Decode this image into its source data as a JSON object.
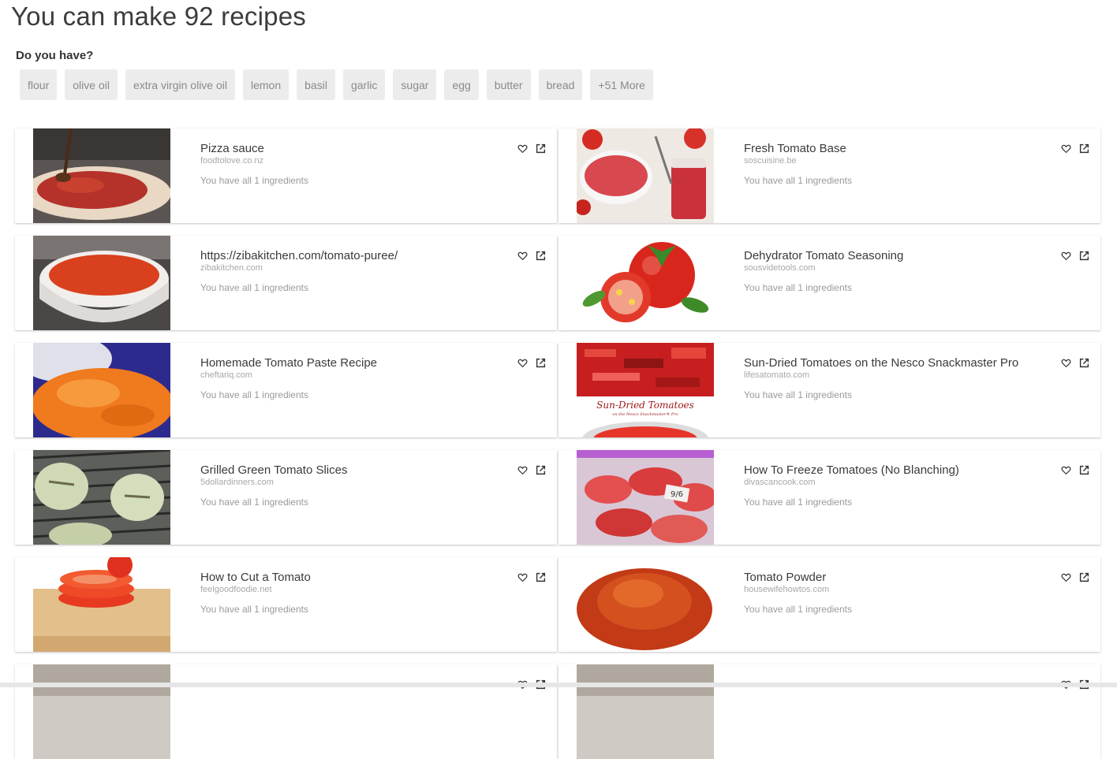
{
  "page": {
    "title": "You can make 92 recipes",
    "subheading": "Do you have?"
  },
  "chips": [
    "flour",
    "olive oil",
    "extra virgin olive oil",
    "lemon",
    "basil",
    "garlic",
    "sugar",
    "egg",
    "butter",
    "bread",
    "+51 More"
  ],
  "recipes": [
    {
      "title": "Pizza sauce",
      "source": "foodtolove.co.nz",
      "have": "You have all 1 ingredients",
      "image": "pizza-sauce-photo"
    },
    {
      "title": "Fresh Tomato Base",
      "source": "soscuisine.be",
      "have": "You have all 1 ingredients",
      "image": "tomato-base-photo"
    },
    {
      "title": "https://zibakitchen.com/tomato-puree/",
      "source": "zibakitchen.com",
      "have": "You have all 1 ingredients",
      "image": "tomato-puree-photo"
    },
    {
      "title": "Dehydrator Tomato Seasoning",
      "source": "sousvidetools.com",
      "have": "You have all 1 ingredients",
      "image": "tomatoes-photo"
    },
    {
      "title": "Homemade Tomato Paste Recipe",
      "source": "cheftariq.com",
      "have": "You have all 1 ingredients",
      "image": "tomato-paste-photo"
    },
    {
      "title": "Sun-Dried Tomatoes on the Nesco Snackmaster Pro",
      "source": "lifesatomato.com",
      "have": "You have all 1 ingredients",
      "image": "sun-dried-tomatoes-photo"
    },
    {
      "title": "Grilled Green Tomato Slices",
      "source": "5dollardinners.com",
      "have": "You have all 1 ingredients",
      "image": "grilled-green-tomato-photo"
    },
    {
      "title": "How To Freeze Tomatoes (No Blanching)",
      "source": "divascancook.com",
      "have": "You have all 1 ingredients",
      "image": "frozen-tomatoes-photo"
    },
    {
      "title": "How to Cut a Tomato",
      "source": "feelgoodfoodie.net",
      "have": "You have all 1 ingredients",
      "image": "cut-tomato-photo"
    },
    {
      "title": "Tomato Powder",
      "source": "housewifehowtos.com",
      "have": "You have all 1 ingredients",
      "image": "tomato-powder-photo"
    },
    {
      "title": "",
      "source": "",
      "have": "",
      "image": "partial-photo"
    },
    {
      "title": "",
      "source": "",
      "have": "",
      "image": "partial-photo"
    }
  ],
  "colors": {
    "chip_bg": "#ececec",
    "chip_text": "#8a8a8a",
    "title": "#3c3c3c",
    "muted": "#a8a8a8"
  }
}
